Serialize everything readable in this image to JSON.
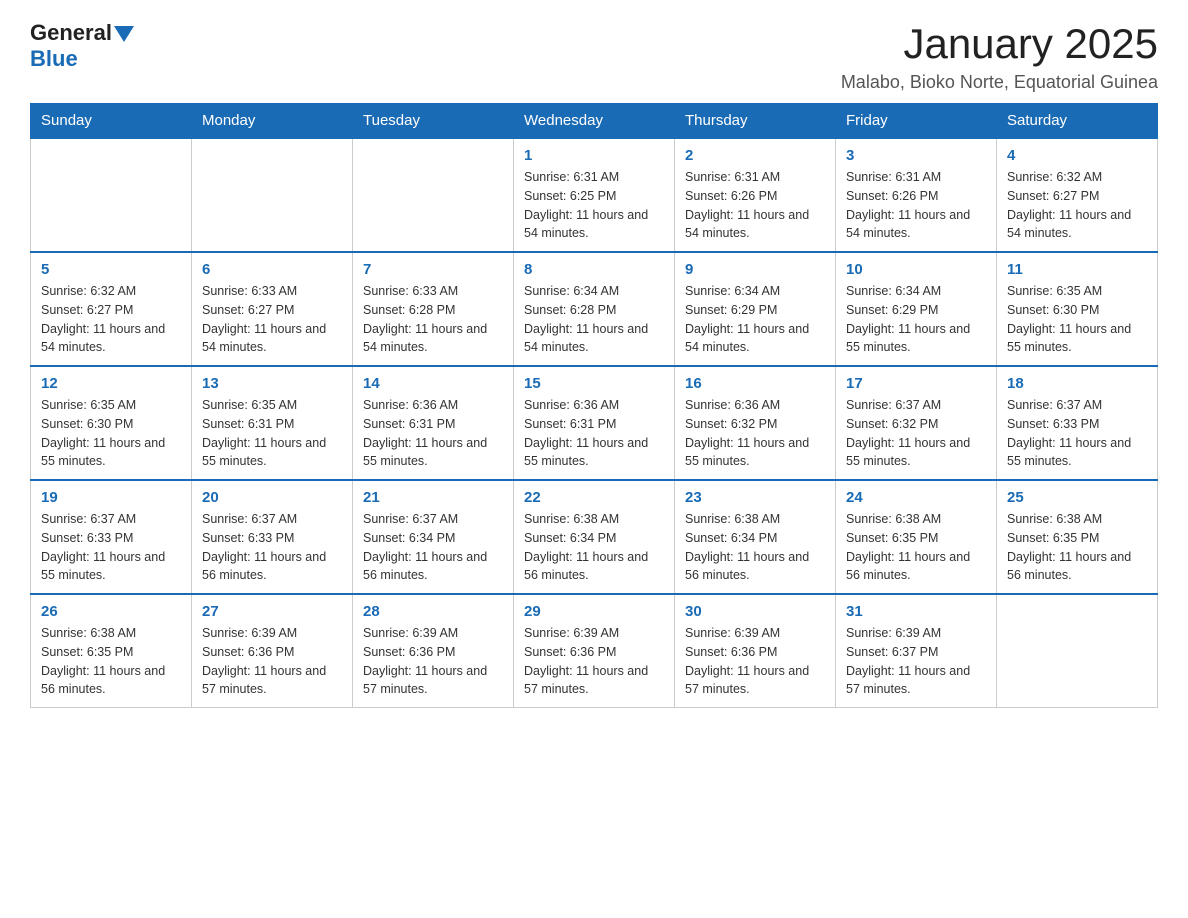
{
  "header": {
    "logo_general": "General",
    "logo_blue": "Blue",
    "title": "January 2025",
    "location": "Malabo, Bioko Norte, Equatorial Guinea"
  },
  "days_of_week": [
    "Sunday",
    "Monday",
    "Tuesday",
    "Wednesday",
    "Thursday",
    "Friday",
    "Saturday"
  ],
  "weeks": [
    [
      {
        "day": "",
        "info": ""
      },
      {
        "day": "",
        "info": ""
      },
      {
        "day": "",
        "info": ""
      },
      {
        "day": "1",
        "info": "Sunrise: 6:31 AM\nSunset: 6:25 PM\nDaylight: 11 hours and 54 minutes."
      },
      {
        "day": "2",
        "info": "Sunrise: 6:31 AM\nSunset: 6:26 PM\nDaylight: 11 hours and 54 minutes."
      },
      {
        "day": "3",
        "info": "Sunrise: 6:31 AM\nSunset: 6:26 PM\nDaylight: 11 hours and 54 minutes."
      },
      {
        "day": "4",
        "info": "Sunrise: 6:32 AM\nSunset: 6:27 PM\nDaylight: 11 hours and 54 minutes."
      }
    ],
    [
      {
        "day": "5",
        "info": "Sunrise: 6:32 AM\nSunset: 6:27 PM\nDaylight: 11 hours and 54 minutes."
      },
      {
        "day": "6",
        "info": "Sunrise: 6:33 AM\nSunset: 6:27 PM\nDaylight: 11 hours and 54 minutes."
      },
      {
        "day": "7",
        "info": "Sunrise: 6:33 AM\nSunset: 6:28 PM\nDaylight: 11 hours and 54 minutes."
      },
      {
        "day": "8",
        "info": "Sunrise: 6:34 AM\nSunset: 6:28 PM\nDaylight: 11 hours and 54 minutes."
      },
      {
        "day": "9",
        "info": "Sunrise: 6:34 AM\nSunset: 6:29 PM\nDaylight: 11 hours and 54 minutes."
      },
      {
        "day": "10",
        "info": "Sunrise: 6:34 AM\nSunset: 6:29 PM\nDaylight: 11 hours and 55 minutes."
      },
      {
        "day": "11",
        "info": "Sunrise: 6:35 AM\nSunset: 6:30 PM\nDaylight: 11 hours and 55 minutes."
      }
    ],
    [
      {
        "day": "12",
        "info": "Sunrise: 6:35 AM\nSunset: 6:30 PM\nDaylight: 11 hours and 55 minutes."
      },
      {
        "day": "13",
        "info": "Sunrise: 6:35 AM\nSunset: 6:31 PM\nDaylight: 11 hours and 55 minutes."
      },
      {
        "day": "14",
        "info": "Sunrise: 6:36 AM\nSunset: 6:31 PM\nDaylight: 11 hours and 55 minutes."
      },
      {
        "day": "15",
        "info": "Sunrise: 6:36 AM\nSunset: 6:31 PM\nDaylight: 11 hours and 55 minutes."
      },
      {
        "day": "16",
        "info": "Sunrise: 6:36 AM\nSunset: 6:32 PM\nDaylight: 11 hours and 55 minutes."
      },
      {
        "day": "17",
        "info": "Sunrise: 6:37 AM\nSunset: 6:32 PM\nDaylight: 11 hours and 55 minutes."
      },
      {
        "day": "18",
        "info": "Sunrise: 6:37 AM\nSunset: 6:33 PM\nDaylight: 11 hours and 55 minutes."
      }
    ],
    [
      {
        "day": "19",
        "info": "Sunrise: 6:37 AM\nSunset: 6:33 PM\nDaylight: 11 hours and 55 minutes."
      },
      {
        "day": "20",
        "info": "Sunrise: 6:37 AM\nSunset: 6:33 PM\nDaylight: 11 hours and 56 minutes."
      },
      {
        "day": "21",
        "info": "Sunrise: 6:37 AM\nSunset: 6:34 PM\nDaylight: 11 hours and 56 minutes."
      },
      {
        "day": "22",
        "info": "Sunrise: 6:38 AM\nSunset: 6:34 PM\nDaylight: 11 hours and 56 minutes."
      },
      {
        "day": "23",
        "info": "Sunrise: 6:38 AM\nSunset: 6:34 PM\nDaylight: 11 hours and 56 minutes."
      },
      {
        "day": "24",
        "info": "Sunrise: 6:38 AM\nSunset: 6:35 PM\nDaylight: 11 hours and 56 minutes."
      },
      {
        "day": "25",
        "info": "Sunrise: 6:38 AM\nSunset: 6:35 PM\nDaylight: 11 hours and 56 minutes."
      }
    ],
    [
      {
        "day": "26",
        "info": "Sunrise: 6:38 AM\nSunset: 6:35 PM\nDaylight: 11 hours and 56 minutes."
      },
      {
        "day": "27",
        "info": "Sunrise: 6:39 AM\nSunset: 6:36 PM\nDaylight: 11 hours and 57 minutes."
      },
      {
        "day": "28",
        "info": "Sunrise: 6:39 AM\nSunset: 6:36 PM\nDaylight: 11 hours and 57 minutes."
      },
      {
        "day": "29",
        "info": "Sunrise: 6:39 AM\nSunset: 6:36 PM\nDaylight: 11 hours and 57 minutes."
      },
      {
        "day": "30",
        "info": "Sunrise: 6:39 AM\nSunset: 6:36 PM\nDaylight: 11 hours and 57 minutes."
      },
      {
        "day": "31",
        "info": "Sunrise: 6:39 AM\nSunset: 6:37 PM\nDaylight: 11 hours and 57 minutes."
      },
      {
        "day": "",
        "info": ""
      }
    ]
  ]
}
